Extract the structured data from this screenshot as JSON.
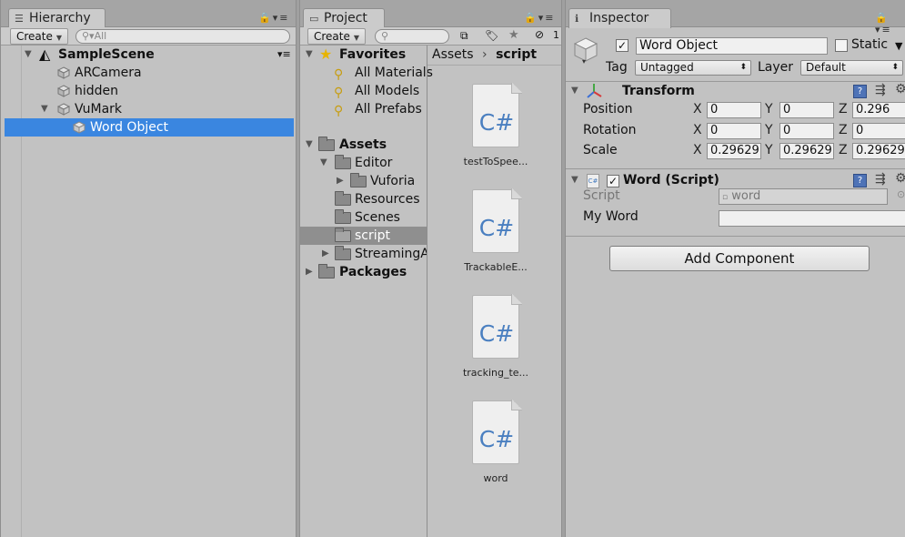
{
  "hierarchy": {
    "tab_title": "Hierarchy",
    "create_label": "Create",
    "search_placeholder": "All",
    "scene_name": "SampleScene",
    "items": [
      "ARCamera",
      "hidden",
      "VuMark",
      "Word Object"
    ]
  },
  "project": {
    "tab_title": "Project",
    "create_label": "Create",
    "filter_count": "1",
    "favorites_label": "Favorites",
    "favorites": [
      "All Materials",
      "All Models",
      "All Prefabs"
    ],
    "assets_label": "Assets",
    "folders": [
      "Editor",
      "Vuforia",
      "Resources",
      "Scenes",
      "script",
      "StreamingA"
    ],
    "packages_label": "Packages",
    "breadcrumb": [
      "Assets",
      "script"
    ],
    "files": [
      "testToSpee...",
      "TrackableE...",
      "tracking_te...",
      "word"
    ],
    "file_icon_text": "C#"
  },
  "inspector": {
    "tab_title": "Inspector",
    "object_name": "Word Object",
    "static_label": "Static",
    "tag_label": "Tag",
    "tag_value": "Untagged",
    "layer_label": "Layer",
    "layer_value": "Default",
    "transform_title": "Transform",
    "position_label": "Position",
    "rotation_label": "Rotation",
    "scale_label": "Scale",
    "axis_x": "X",
    "axis_y": "Y",
    "axis_z": "Z",
    "position": [
      "0",
      "0",
      "0.296"
    ],
    "rotation": [
      "0",
      "0",
      "0"
    ],
    "scale": [
      "0.29629",
      "0.29629",
      "0.29629"
    ],
    "script_component_title": "Word (Script)",
    "script_label": "Script",
    "script_value": "word",
    "myword_label": "My Word",
    "myword_value": "",
    "add_component_label": "Add Component"
  },
  "colors": {
    "selection": "#3a86e0",
    "panel_bg": "#c2c2c2",
    "csharp_blue": "#4a7fc0"
  }
}
